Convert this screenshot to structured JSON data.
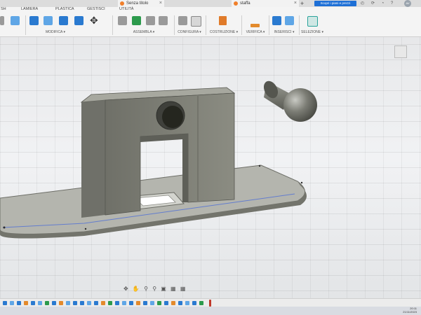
{
  "tabs": [
    {
      "label": "Senza titolo",
      "active": true
    },
    {
      "label": "staffa",
      "active": false
    }
  ],
  "signin_label": "Scopri i piani e prezzi",
  "avatar_initials": "AV",
  "ribbon_tabs": [
    "SH",
    "LAMIERA",
    "PLASTICA",
    "GESTISCI",
    "UTILITÀ"
  ],
  "groups": {
    "modifica": "MODIFICA ▾",
    "assembla": "ASSEMBLA ▾",
    "configura": "CONFIGURA ▾",
    "costruzione": "COSTRUZIONE ▾",
    "verifica": "VERIFICA ▾",
    "inserisci": "INSERISCI ▾",
    "selezione": "SELEZIONE ▾"
  },
  "clock": {
    "time": "20:11",
    "date": "21/11/2023"
  },
  "colors": {
    "accent": "#1d6fd6",
    "body": "#83847a",
    "background": "#ebeced"
  }
}
